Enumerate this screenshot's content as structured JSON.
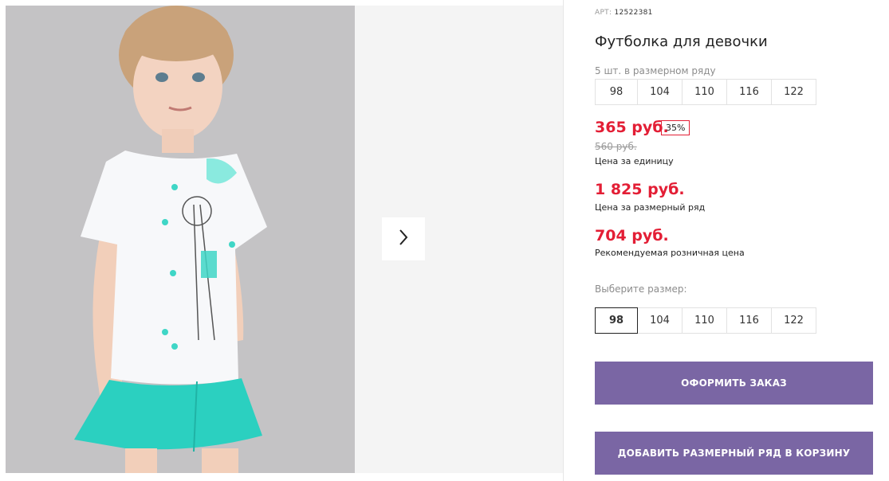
{
  "product": {
    "art_label": "АРТ:",
    "art_value": "12522381",
    "title": "Футболка для девочки",
    "pack_note": "5 шт. в размерном ряду",
    "pack_sizes": [
      "98",
      "104",
      "110",
      "116",
      "122"
    ],
    "price_unit": "365 руб.",
    "discount": "35%",
    "old_price": "560 руб.",
    "price_unit_caption": "Цена за единицу",
    "price_pack": "1 825 руб.",
    "price_pack_caption": "Цена за размерный ряд",
    "price_retail": "704 руб.",
    "price_retail_caption": "Рекомендуемая розничная цена",
    "choose_size_label": "Выберите размер:",
    "sizes": [
      "98",
      "104",
      "110",
      "116",
      "122"
    ],
    "selected_size": "98",
    "order_button": "ОФОРМИТЬ ЗАКАЗ",
    "add_pack_button": "ДОБАВИТЬ РАЗМЕРНЫЙ РЯД В КОРЗИНУ"
  },
  "colors": {
    "accent_button": "#7a66a4",
    "price_red": "#e31e35",
    "tshirt_print": "#3fd6c6",
    "skirt": "#2bd0c0"
  },
  "icons": {
    "next": "chevron-right-icon"
  }
}
